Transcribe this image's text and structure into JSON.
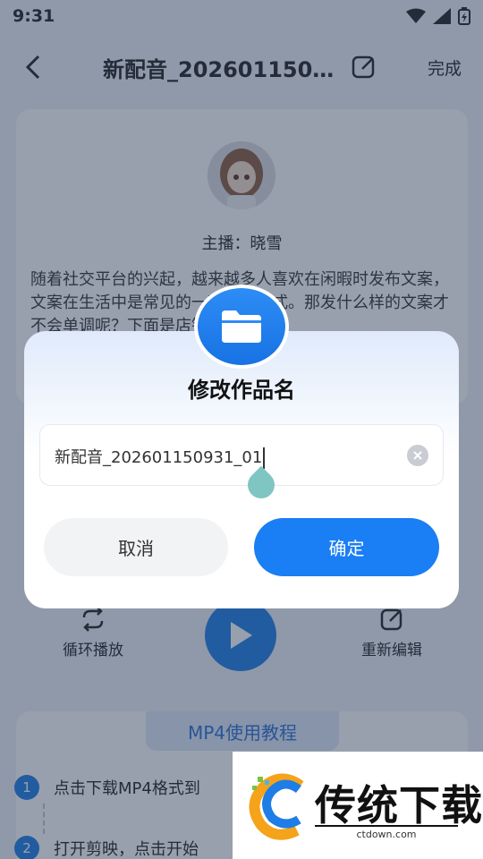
{
  "status_bar": {
    "time": "9:31"
  },
  "header": {
    "title": "新配音_2026011509...",
    "done_label": "完成"
  },
  "voice_card": {
    "host_label": "主播：晓雪",
    "script_text": "随着社交平台的兴起，越来越多人喜欢在闲暇时发布文案，文案在生活中是常见的一种宣传形式。那发什么样的文案才不会单调呢？下面是店铺为大家"
  },
  "controls": {
    "loop_label": "循环播放",
    "reedit_label": "重新编辑"
  },
  "tutorial": {
    "title": "MP4使用教程",
    "steps": [
      {
        "num": "1",
        "text": "点击下载MP4格式到"
      },
      {
        "num": "2",
        "text": "打开剪映，点击开始"
      }
    ]
  },
  "dialog": {
    "title": "修改作品名",
    "input_value": "新配音_202601150931_01",
    "cancel_label": "取消",
    "confirm_label": "确定"
  },
  "watermark": {
    "brand": "传统下载",
    "url": "ctdown.com"
  },
  "colors": {
    "accent": "#1a7ef4",
    "overlay": "rgba(40,56,84,0.48)"
  }
}
